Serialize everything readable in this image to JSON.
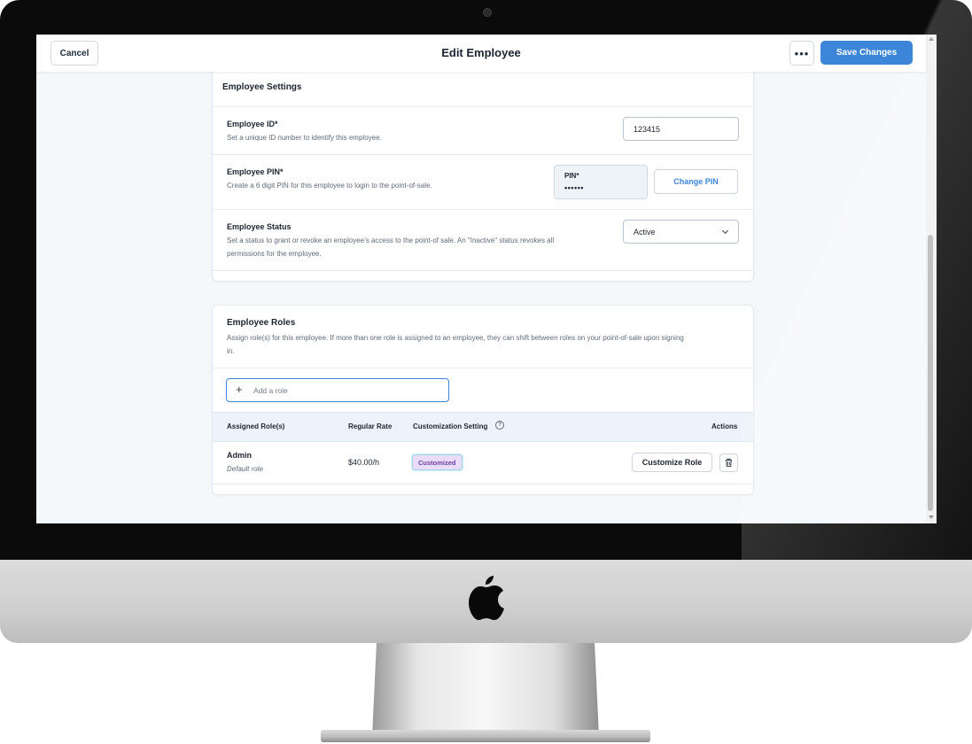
{
  "header": {
    "cancel_label": "Cancel",
    "title": "Edit Employee",
    "more_label": "•••",
    "save_label": "Save Changes"
  },
  "settings": {
    "title": "Employee Settings",
    "employee_id": {
      "label": "Employee ID*",
      "help": "Set a unique ID number to identify this employee.",
      "value": "123415"
    },
    "employee_pin": {
      "label": "Employee PIN*",
      "help": "Create a 6 digit PIN for this employee to login to the point-of-sale.",
      "field_label": "PIN*",
      "masked_value": "••••••",
      "change_button": "Change PIN"
    },
    "employee_status": {
      "label": "Employee Status",
      "help_line1": "Set a status to grant or revoke an employee's access to the point-of sale. An \"Inactive\" status revokes all",
      "help_line2": "permissions for the employee.",
      "value": "Active"
    }
  },
  "roles": {
    "title": "Employee Roles",
    "description_line1": "Assign role(s) for this employee. If more than one role is assigned to an employee, they can shift between roles on your point-of-sale upon signing",
    "description_line2": "in.",
    "add_placeholder": "Add a role",
    "columns": {
      "assigned": "Assigned Role(s)",
      "rate": "Regular Rate",
      "customization": "Customization Setting",
      "actions": "Actions"
    },
    "rows": [
      {
        "name": "Admin",
        "subtitle": "Default role",
        "rate": "$40.00/h",
        "customization": "Customized",
        "action_label": "Customize Role"
      }
    ]
  },
  "colors": {
    "primary": "#3d85d8",
    "badge_bg": "#eadcf8",
    "badge_text": "#6b3fa0",
    "page_bg": "#f5f8fb"
  },
  "icons": [
    "apple-logo-icon",
    "more-icon",
    "chevron-down-icon",
    "plus-icon",
    "help-circle-icon",
    "trash-icon"
  ]
}
